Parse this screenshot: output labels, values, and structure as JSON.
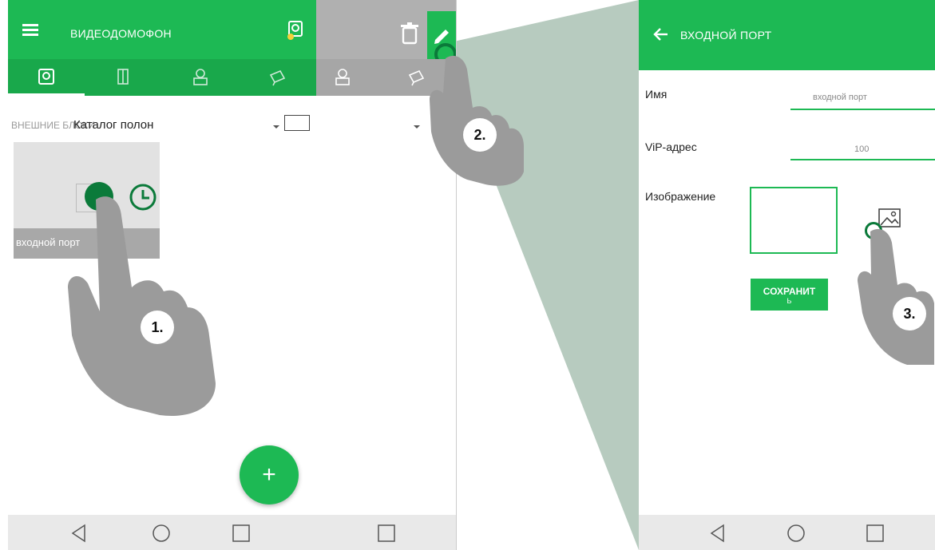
{
  "screen1": {
    "title": "ВИДЕОДОМОФОН",
    "tabs": [
      "monitor-icon",
      "door-icon",
      "person-icon",
      "camera-icon"
    ],
    "section_label": "ВНЕШНИЕ БЛОКИ",
    "overlay_label": "Каталог полон",
    "card_label": "входной порт",
    "fab_label": "+"
  },
  "screen3": {
    "title": "ВХОДНОЙ ПОРТ",
    "name_label": "Имя",
    "name_value": "входной порт",
    "vip_label": "ViP-адрес",
    "vip_value": "100",
    "image_label": "Изображение",
    "save_line1": "СОХРАНИТ",
    "save_line2": "Ь"
  },
  "steps": [
    "1.",
    "2.",
    "3."
  ],
  "colors": {
    "accent": "#1db954",
    "accent_dark": "#0b7a3a",
    "hand": "#9b9b9b"
  }
}
